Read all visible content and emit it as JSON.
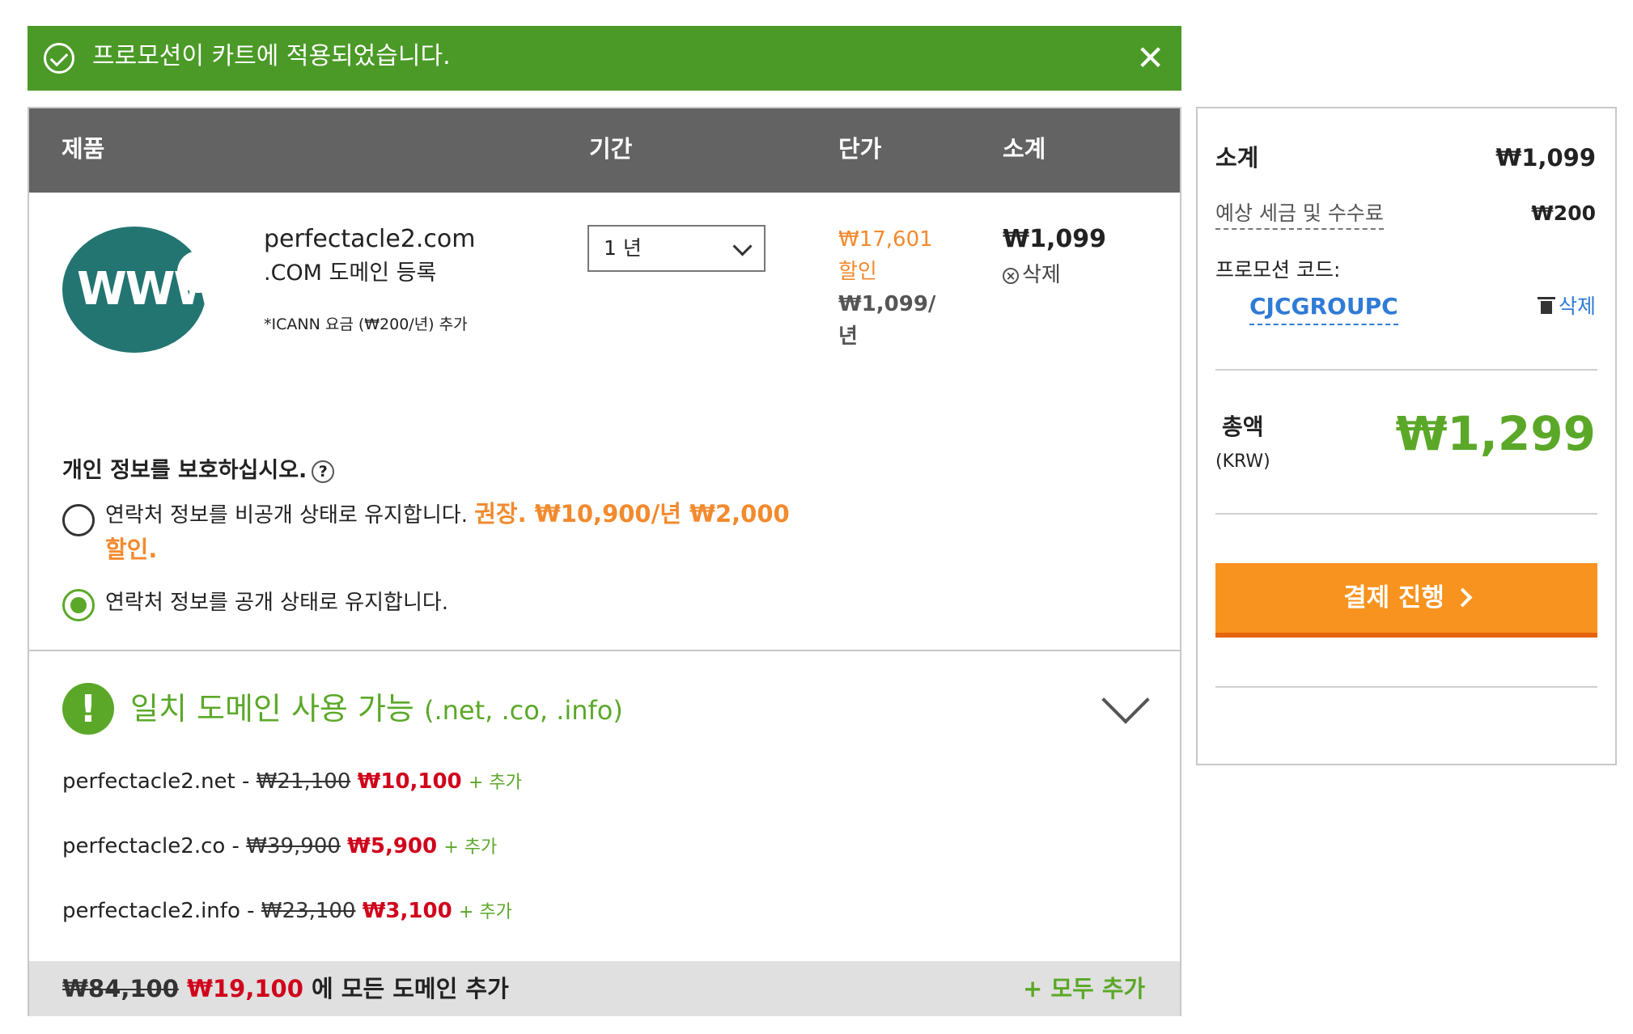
{
  "banner": {
    "message": "프로모션이 카트에 적용되었습니다.",
    "close": "✕"
  },
  "table": {
    "headers": {
      "product": "제품",
      "term": "기간",
      "unit_price": "단가",
      "subtotal": "소계"
    }
  },
  "item": {
    "icon_text": "WWW",
    "domain": "perfectacle2.com",
    "description": ".COM 도메인 등록",
    "note": "*ICANN 요금 (₩200/년) 추가",
    "term": "1 년",
    "original_price": "₩17,601",
    "discount_label": "할인",
    "unit_price": "₩1,099/년",
    "subtotal": "₩1,099",
    "delete": "삭제"
  },
  "privacy": {
    "title": "개인 정보를 보호하십시오.",
    "help": "?",
    "options": [
      {
        "text": "연락처 정보를 비공개 상태로 유지합니다. ",
        "recommend": "권장. ₩10,900/년 ₩2,000 할인.",
        "selected": false
      },
      {
        "text": "연락처 정보를 공개 상태로 유지합니다.",
        "selected": true
      }
    ]
  },
  "matches": {
    "title": "일치 도메인 사용 가능",
    "extensions": "(.net, .co, .info)",
    "items": [
      {
        "domain": "perfectacle2.net",
        "sep": " - ",
        "old_price": "₩21,100",
        "new_price": "₩10,100",
        "add": "+ 추가"
      },
      {
        "domain": "perfectacle2.co",
        "sep": " - ",
        "old_price": "₩39,900",
        "new_price": "₩5,900",
        "add": "+ 추가"
      },
      {
        "domain": "perfectacle2.info",
        "sep": " - ",
        "old_price": "₩23,100",
        "new_price": "₩3,100",
        "add": "+ 추가"
      }
    ],
    "bundle": {
      "old_price": "₩84,100",
      "new_price": "₩19,100",
      "text": " 에 모든 도메인 추가",
      "add_all": "+ 모두 추가"
    }
  },
  "summary": {
    "subtotal_label": "소계",
    "subtotal_value": "₩1,099",
    "tax_label": "예상 세금 및 수수료",
    "tax_value": "₩200",
    "promo_label": "프로모션 코드:",
    "promo_code": "CJCGROUPC",
    "promo_delete": "삭제",
    "total_label": "총액",
    "currency": "(KRW)",
    "total_value": "₩1,299",
    "checkout": "결제 진행"
  },
  "colors": {
    "banner_green": "#4b9a27",
    "accent_green": "#5ba829",
    "orange": "#f7931e",
    "price_red": "#d0021b",
    "link_blue": "#2f7bd6",
    "header_gray": "#636363"
  },
  "icons": [
    "check-circle-icon",
    "close-icon",
    "www-icon",
    "chevron-down-icon",
    "remove-circle-icon",
    "help-icon",
    "exclamation-icon",
    "trash-icon",
    "chevron-right-icon"
  ]
}
